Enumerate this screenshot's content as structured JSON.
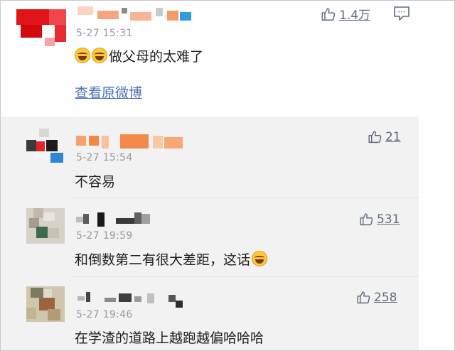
{
  "main_comment": {
    "timestamp": "5-27 15:31",
    "text": "做父母的太难了",
    "likes": "1.4万",
    "view_original_link": "查看原微博"
  },
  "replies": [
    {
      "timestamp": "5-27 15:54",
      "text": "不容易",
      "likes": "21"
    },
    {
      "timestamp": "5-27 19:59",
      "text": "和倒数第二有很大差距，这话",
      "likes": "531"
    },
    {
      "timestamp": "5-27 19:46",
      "text": "在学渣的道路上越跑越偏哈哈哈",
      "likes": "258"
    }
  ],
  "colors": {
    "link": "#4a6fb5",
    "like_count": "#5f6b80",
    "timestamp": "#9a9a9a",
    "reply_background": "#f2f2f2"
  },
  "icons": {
    "like": "thumbs-up-icon",
    "comment": "chat-bubble-icon",
    "emoji": "laughing-tears-emoji"
  }
}
